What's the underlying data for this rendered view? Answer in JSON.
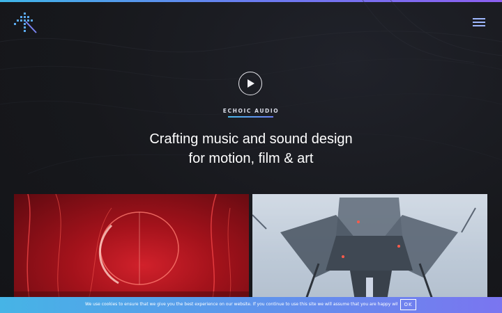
{
  "header": {
    "logo_icon": "echoic-audio-logo-icon",
    "menu_icon": "hamburger-menu-icon"
  },
  "hero": {
    "play_icon": "play-icon",
    "brand": "ECHOIC AUDIO",
    "headline_line1": "Crafting music and sound design",
    "headline_line2": "for motion, film & art"
  },
  "cards": [
    {
      "name": "red-cylinder-project",
      "accent": "#c0161f"
    },
    {
      "name": "cross-structure-project",
      "accent": "#c5d1de"
    }
  ],
  "cookie_banner": {
    "text": "We use cookies to ensure that we give you the best experience on our website. If you continue to use this site we will assume that you are happy with it.",
    "ok_label": "OK"
  },
  "colors": {
    "accent_blue": "#46b4e6",
    "accent_purple": "#7a75f0",
    "background": "#17181c"
  }
}
